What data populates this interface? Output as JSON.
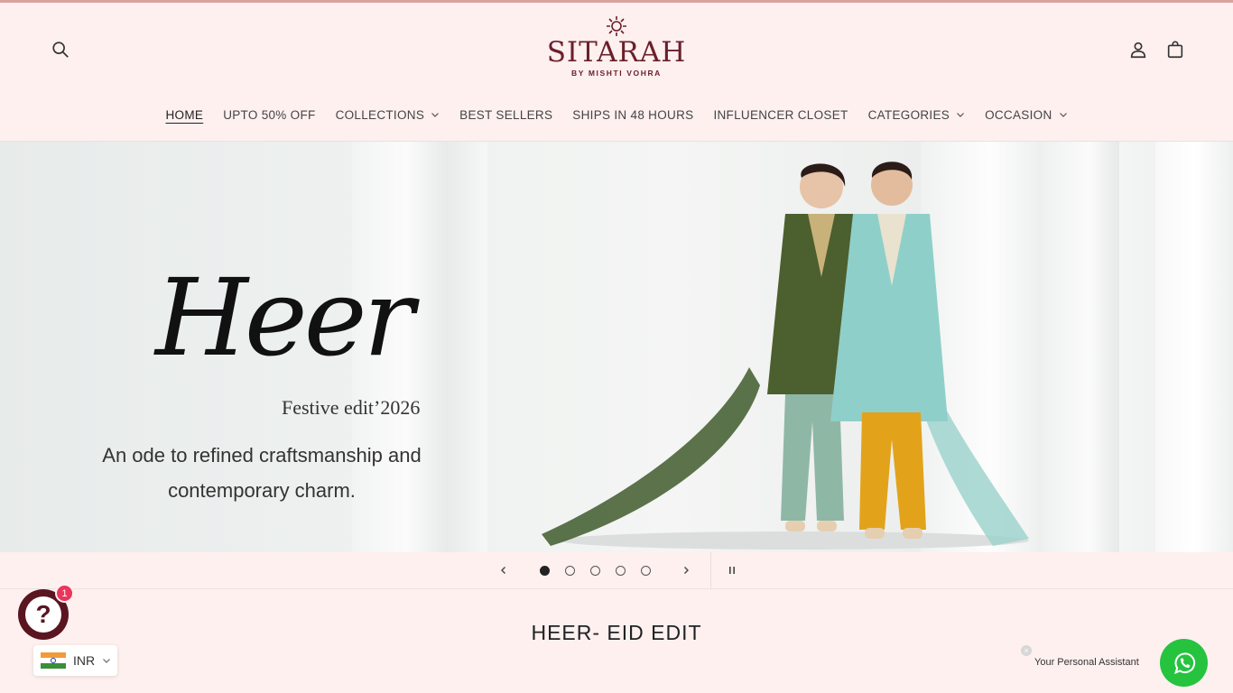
{
  "brand": {
    "name": "SITARAH",
    "subtitle": "BY MISHTI VOHRA",
    "color": "#6b1f2a"
  },
  "header_icons": {
    "search": "search-icon",
    "account": "user-icon",
    "cart": "bag-icon"
  },
  "nav": {
    "items": [
      {
        "label": "HOME",
        "active": true,
        "dropdown": false
      },
      {
        "label": "UPTO 50% OFF",
        "active": false,
        "dropdown": false
      },
      {
        "label": "COLLECTIONS",
        "active": false,
        "dropdown": true
      },
      {
        "label": "BEST SELLERS",
        "active": false,
        "dropdown": false
      },
      {
        "label": "SHIPS IN 48 HOURS",
        "active": false,
        "dropdown": false
      },
      {
        "label": "INFLUENCER CLOSET",
        "active": false,
        "dropdown": false
      },
      {
        "label": "CATEGORIES",
        "active": false,
        "dropdown": true
      },
      {
        "label": "OCCASION",
        "active": false,
        "dropdown": true
      }
    ]
  },
  "hero": {
    "title": "Heer",
    "subtitle": "Festive edit’2026",
    "tagline_line1": "An ode to refined craftsmanship and",
    "tagline_line2": "contemporary charm."
  },
  "slider": {
    "slide_count": 5,
    "active_index": 0
  },
  "section": {
    "title": "HEER- EID EDIT"
  },
  "chat_widget": {
    "badge_count": "1",
    "symbol": "?"
  },
  "currency": {
    "code": "INR"
  },
  "assistant": {
    "label": "Your Personal Assistant",
    "close_symbol": "×"
  },
  "colors": {
    "background": "#fdf0ef",
    "accent": "#6b1f2a",
    "whatsapp": "#26c33f",
    "badge": "#e8365c"
  }
}
